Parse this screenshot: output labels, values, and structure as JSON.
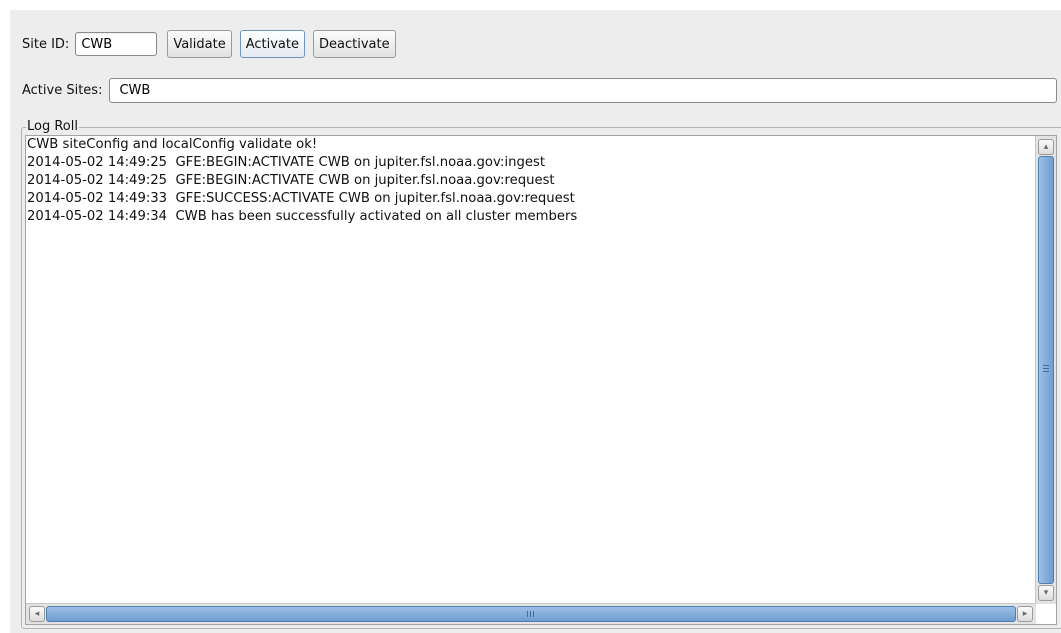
{
  "site": {
    "label": "Site ID:",
    "value": "CWB"
  },
  "buttons": {
    "validate": "Validate",
    "activate": "Activate",
    "deactivate": "Deactivate"
  },
  "active_sites": {
    "label": "Active Sites:",
    "value": "CWB"
  },
  "log": {
    "title": "Log Roll",
    "lines": [
      "CWB siteConfig and localConfig validate ok!",
      "2014-05-02 14:49:25  GFE:BEGIN:ACTIVATE CWB on jupiter.fsl.noaa.gov:ingest",
      "2014-05-02 14:49:25  GFE:BEGIN:ACTIVATE CWB on jupiter.fsl.noaa.gov:request",
      "2014-05-02 14:49:33  GFE:SUCCESS:ACTIVATE CWB on jupiter.fsl.noaa.gov:request",
      "2014-05-02 14:49:34  CWB has been successfully activated on all cluster members"
    ]
  },
  "icons": {
    "scroll_up": "▴",
    "scroll_down": "▾",
    "scroll_left": "◂",
    "scroll_right": "▸"
  },
  "colors": {
    "accent": "#6f9dd0",
    "window_bg": "#ededed"
  }
}
